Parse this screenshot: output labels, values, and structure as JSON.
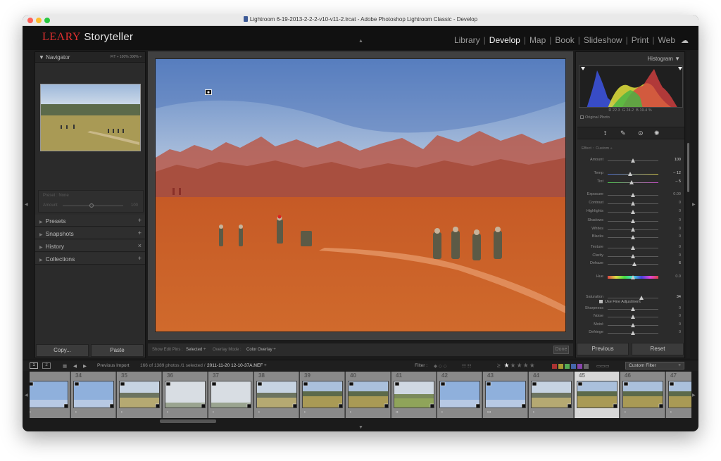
{
  "window": {
    "title": "Lightroom 6-19-2013-2-2-2-v10-v11-2.lrcat - Adobe Photoshop Lightroom Classic - Develop"
  },
  "identity_plate": {
    "brand": "LEARY",
    "text": "Storyteller"
  },
  "modules": [
    {
      "label": "Library",
      "active": false
    },
    {
      "label": "Develop",
      "active": true
    },
    {
      "label": "Map",
      "active": false
    },
    {
      "label": "Book",
      "active": false
    },
    {
      "label": "Slideshow",
      "active": false
    },
    {
      "label": "Print",
      "active": false
    },
    {
      "label": "Web",
      "active": false
    }
  ],
  "left_panel": {
    "navigator": {
      "label": "Navigator",
      "zoom_options": "FIT ÷  100%  300% ÷"
    },
    "preset_box": {
      "label": "Preset : None",
      "amount_label": "Amount",
      "amount_value": "100"
    },
    "sections": [
      {
        "label": "Presets",
        "action": "+"
      },
      {
        "label": "Snapshots",
        "action": "+"
      },
      {
        "label": "History",
        "action": "×"
      },
      {
        "label": "Collections",
        "action": "+"
      }
    ],
    "copy_label": "Copy...",
    "paste_label": "Paste"
  },
  "toolbar": {
    "show_pins_label": "Show Edit Pins :",
    "show_pins_value": "Selected ÷",
    "overlay_label": "Overlay Mode :",
    "overlay_value": "Color Overlay ÷",
    "done_label": "Done"
  },
  "right_panel": {
    "histogram_label": "Histogram",
    "rgb": {
      "r_label": "R",
      "r": "22.3",
      "g_label": "G",
      "g": "24.2",
      "b_label": "B",
      "b": "19.4",
      "unit": "%"
    },
    "original_photo_label": "Original Photo",
    "effect_label": "Effect :",
    "effect_value": "Custom ÷",
    "sliders": [
      {
        "label": "Amount",
        "value": "100",
        "pos": 0.5,
        "bright": true
      },
      {
        "label": "Temp",
        "value": "– 12",
        "pos": 0.44,
        "bright": true
      },
      {
        "label": "Tint",
        "value": "– 5",
        "pos": 0.47,
        "bright": true
      },
      {
        "label": "Exposure",
        "value": "0.00",
        "pos": 0.5,
        "bright": false
      },
      {
        "label": "Contrast",
        "value": "0",
        "pos": 0.5,
        "bright": false
      },
      {
        "label": "Highlights",
        "value": "0",
        "pos": 0.5,
        "bright": false
      },
      {
        "label": "Shadows",
        "value": "0",
        "pos": 0.5,
        "bright": false
      },
      {
        "label": "Whites",
        "value": "0",
        "pos": 0.5,
        "bright": false
      },
      {
        "label": "Blacks",
        "value": "0",
        "pos": 0.5,
        "bright": false
      },
      {
        "label": "Texture",
        "value": "0",
        "pos": 0.5,
        "bright": false
      },
      {
        "label": "Clarity",
        "value": "0",
        "pos": 0.5,
        "bright": false
      },
      {
        "label": "Dehaze",
        "value": "6",
        "pos": 0.53,
        "bright": true
      },
      {
        "label": "Hue",
        "value": "0.0",
        "pos": 0.5,
        "bright": false
      },
      {
        "label": "Saturation",
        "value": "34",
        "pos": 0.67,
        "bright": true
      },
      {
        "label": "Sharpness",
        "value": "0",
        "pos": 0.5,
        "bright": false
      },
      {
        "label": "Noise",
        "value": "0",
        "pos": 0.5,
        "bright": false
      },
      {
        "label": "Moiré",
        "value": "0",
        "pos": 0.5,
        "bright": false
      },
      {
        "label": "Defringe",
        "value": "0",
        "pos": 0.5,
        "bright": false
      }
    ],
    "fine_adjust_label": "Use Fine Adjustment",
    "previous_label": "Previous",
    "reset_label": "Reset"
  },
  "filmbar": {
    "view1": "1",
    "view2": "2",
    "source": "Previous Import",
    "count": "166 of 1389 photos /1 selected /",
    "filename": "2011-11-20 12-10-37A.NEF ÷",
    "filter_label": "Filter :",
    "rating_op": "≥",
    "stars_on": "★",
    "stars_off": "★★★★",
    "custom_filter": "Custom Filter",
    "label_colors": [
      "#a33",
      "#a93",
      "#5a5",
      "#46a",
      "#84a",
      "#666"
    ]
  },
  "filmstrip": [
    {
      "num": "",
      "type": "sky",
      "sel": false,
      "dots": "•"
    },
    {
      "num": "34",
      "type": "sky",
      "sel": false,
      "dots": "•"
    },
    {
      "num": "35",
      "type": "field",
      "sel": false,
      "dots": "•"
    },
    {
      "num": "36",
      "type": "sky2",
      "sel": false,
      "dots": "•"
    },
    {
      "num": "37",
      "type": "sky2",
      "sel": false,
      "dots": "•"
    },
    {
      "num": "38",
      "type": "field",
      "sel": false,
      "dots": "•"
    },
    {
      "num": "39",
      "type": "field2",
      "sel": false,
      "dots": "•"
    },
    {
      "num": "40",
      "type": "field2",
      "sel": false,
      "dots": "•"
    },
    {
      "num": "41",
      "type": "field3",
      "sel": false,
      "dots": "••"
    },
    {
      "num": "42",
      "type": "sky",
      "sel": false,
      "dots": "•"
    },
    {
      "num": "43",
      "type": "sky",
      "sel": false,
      "dots": "•••"
    },
    {
      "num": "44",
      "type": "field",
      "sel": false,
      "dots": "•"
    },
    {
      "num": "45",
      "type": "field2",
      "sel": true,
      "dots": "•"
    },
    {
      "num": "46",
      "type": "field2",
      "sel": false,
      "dots": "•"
    },
    {
      "num": "47",
      "type": "field2",
      "sel": false,
      "dots": "•"
    }
  ]
}
